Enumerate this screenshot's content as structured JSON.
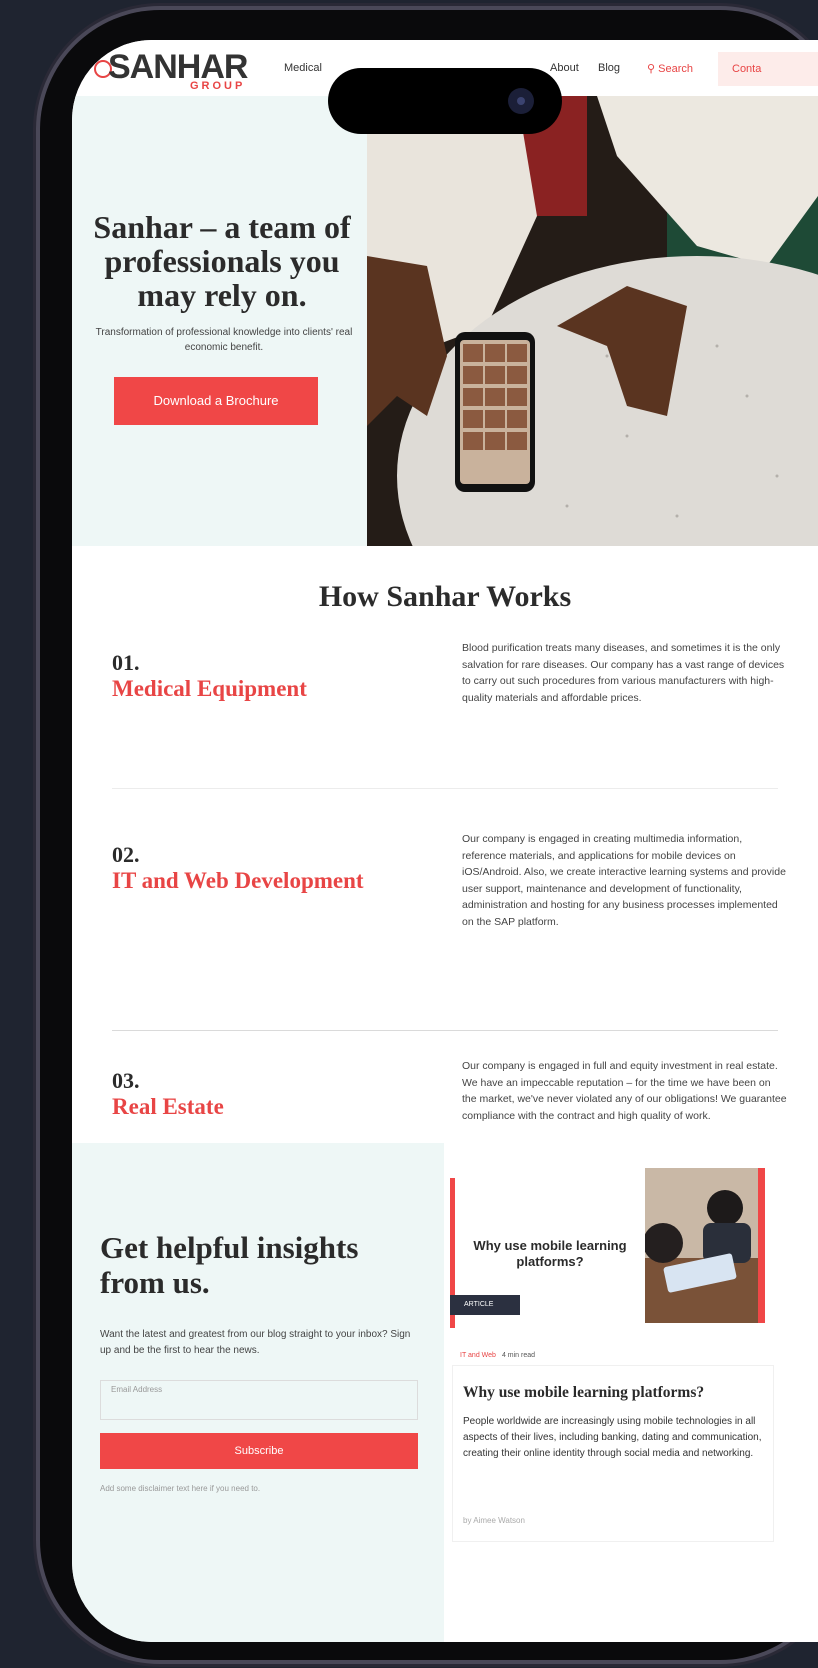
{
  "header": {
    "logo_main": "SANHAR",
    "logo_sub": "GROUP",
    "nav": [
      "Medical",
      "About",
      "Blog"
    ],
    "search_label": "Search",
    "contact_label": "Conta"
  },
  "hero": {
    "title": "Sanhar – a team of professionals you may rely on.",
    "subtitle": "Transformation of professional knowledge into clients' real economic benefit.",
    "button_label": "Download a Brochure"
  },
  "works": {
    "title": "How Sanhar Works",
    "items": [
      {
        "number": "01.",
        "title": "Medical Equipment",
        "description": "Blood purification treats many diseases, and sometimes it is the only salvation for rare diseases. Our company has a vast range of devices to carry out such procedures from various manufacturers with high-quality materials and affordable prices."
      },
      {
        "number": "02.",
        "title": "IT and Web Development",
        "description": "Our company is engaged in creating multimedia information, reference materials, and applications for mobile devices on iOS/Android. Also, we create interactive learning systems and provide user support, maintenance and development of functionality, administration and hosting for any business processes implemented on the SAP platform."
      },
      {
        "number": "03.",
        "title": "Real Estate",
        "description": "Our company is engaged in full and equity investment in real estate. We have an impeccable reputation – for the time we have been on the market, we've never violated any of our obligations! We guarantee compliance with the contract and high quality of work."
      }
    ]
  },
  "insights": {
    "title": "Get helpful insights from us.",
    "subtitle": "Want the latest and greatest from our blog straight to your inbox? Sign up and be the first to hear the news.",
    "email_placeholder": "Email Address",
    "subscribe_label": "Subscribe",
    "disclaimer": "Add some disclaimer text here if you need to."
  },
  "article": {
    "thumb_title": "Why use mobile learning platforms?",
    "badge": "ARTICLE",
    "tag": "IT and Web",
    "read_time": "4 min read",
    "title": "Why use mobile learning platforms?",
    "excerpt": "People worldwide are increasingly using mobile technologies in all aspects of their lives, including banking, dating and communication, creating their online identity through social media and networking.",
    "author": "by Aimee Watson"
  },
  "colors": {
    "accent": "#f04747",
    "mint": "#eef7f6",
    "text": "#2b2b2b",
    "bezel": "#0a0a0c"
  }
}
